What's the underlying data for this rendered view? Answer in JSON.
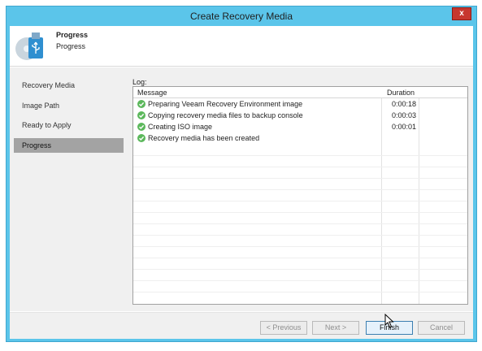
{
  "window": {
    "title": "Create Recovery Media",
    "close_label": "x"
  },
  "header": {
    "title": "Progress",
    "subtitle": "Progress",
    "icon": "usb-media-icon"
  },
  "steps": [
    {
      "label": "Recovery Media",
      "active": false
    },
    {
      "label": "Image Path",
      "active": false
    },
    {
      "label": "Ready to Apply",
      "active": false
    },
    {
      "label": "Progress",
      "active": true
    }
  ],
  "log": {
    "label": "Log:",
    "columns": {
      "message": "Message",
      "duration": "Duration"
    },
    "rows": [
      {
        "message": "Preparing Veeam Recovery Environment image",
        "duration": "0:00:18",
        "status": "success"
      },
      {
        "message": "Copying recovery media files to backup console",
        "duration": "0:00:03",
        "status": "success"
      },
      {
        "message": "Creating ISO image",
        "duration": "0:00:01",
        "status": "success"
      },
      {
        "message": "Recovery media has been created",
        "duration": "",
        "status": "success"
      }
    ]
  },
  "buttons": {
    "previous": "< Previous",
    "next": "Next >",
    "finish": "Finish",
    "cancel": "Cancel"
  },
  "colors": {
    "title_bar": "#5bc5ea",
    "success": "#5cb85c",
    "active_step": "#a3a3a3"
  }
}
